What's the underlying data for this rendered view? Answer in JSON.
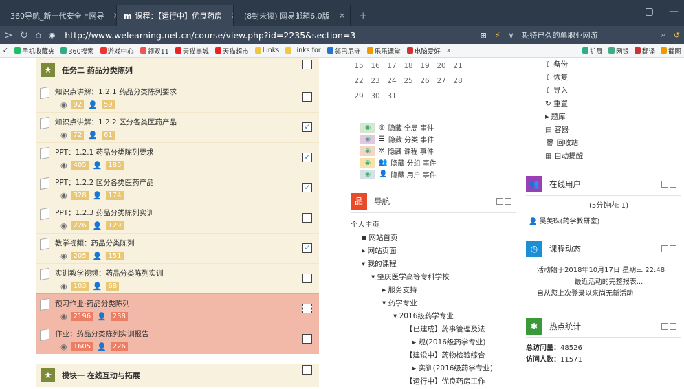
{
  "tabs": [
    {
      "label": "360导航_新一代安全上网导",
      "icon_color": "#f5a623",
      "active": false
    },
    {
      "label": "课程：【运行中】优良药房",
      "icon_color": "#ffffff",
      "active": true
    },
    {
      "label": "(8封未读) 网易邮箱6.0版",
      "icon_color": "#e33",
      "active": false
    }
  ],
  "address": {
    "url": "http://www.welearning.net.cn/course/view.php?id=2235&section=3",
    "hint": "期待已久的单职业网游"
  },
  "bookmarks": [
    "手机收藏夹",
    "360搜索",
    "游戏中心",
    "领双11",
    "天猫商城",
    "天猫超市",
    "Links",
    "Links for",
    "邻巴尼守",
    "乐乐课堂",
    "电脑爱好"
  ],
  "bookmarks_right": [
    "扩展",
    "网银",
    "翻译",
    "截图"
  ],
  "section_title": "任务二 药品分类陈列",
  "items": [
    {
      "name": "知识点讲解：1.2.1 药品分类陈列要求",
      "views": "92",
      "users": "59",
      "checked": false,
      "pink": false
    },
    {
      "name": "知识点讲解：1.2.2 区分各类医药产品",
      "views": "72",
      "users": "61",
      "checked": true,
      "pink": false
    },
    {
      "name": "PPT：1.2.1 药品分类陈列要求",
      "views": "405",
      "users": "185",
      "checked": true,
      "pink": false
    },
    {
      "name": "PPT：1.2.2 区分各类医药产品",
      "views": "328",
      "users": "174",
      "checked": true,
      "pink": false
    },
    {
      "name": "PPT：1.2.3 药品分类陈列实训",
      "views": "226",
      "users": "129",
      "checked": false,
      "pink": false
    },
    {
      "name": "教学视频：药品分类陈列",
      "views": "205",
      "users": "151",
      "checked": true,
      "pink": false
    },
    {
      "name": "实训教学视频：药品分类陈列实训",
      "views": "103",
      "users": "68",
      "checked": false,
      "pink": false
    },
    {
      "name": "预习作业-药品分类陈列",
      "views": "2196",
      "users": "238",
      "checked": false,
      "pink": true,
      "dashed": true
    },
    {
      "name": "作业：药品分类陈列实训报告",
      "views": "1605",
      "users": "226",
      "checked": false,
      "pink": true
    }
  ],
  "module_title": "模块一 在线互动与拓展",
  "calendar": [
    [
      "15",
      "16",
      "17",
      "18",
      "19",
      "20",
      "21"
    ],
    [
      "22",
      "23",
      "24",
      "25",
      "26",
      "27",
      "28"
    ],
    [
      "29",
      "30",
      "31"
    ]
  ],
  "events": [
    "隐藏 全局 事件",
    "隐藏 分类 事件",
    "隐藏 课程 事件",
    "隐藏 分组 事件",
    "隐藏 用户 事件"
  ],
  "nav": {
    "title": "导航",
    "items": [
      "个人主页",
      "网站首页",
      "网站页面",
      "我的课程",
      "肇庆医学高等专科学校",
      "服务支持",
      "药学专业",
      "2016级药学专业",
      "【已建成】药事管理及法",
      "规(2016级药学专业)",
      "【建设中】药物检验综合",
      "实训(2016级药学专业)",
      "【运行中】优良药房工作"
    ]
  },
  "tools": [
    "备份",
    "恢复",
    "导入",
    "重置",
    "题库",
    "容器",
    "回收站",
    "自动提醒"
  ],
  "online": {
    "title": "在线用户",
    "note": "(5分钟内: 1)",
    "user": "吴美珠(药学教研室)"
  },
  "activity": {
    "title": "课程动态",
    "since": "活动始于2018年10月17日 星期三 22:48",
    "link": "最近活动的完整报表...",
    "none": "自从您上次登录以来尚无新活动"
  },
  "stats": {
    "title": "热点统计",
    "visits_label": "总访问量：",
    "visits": "48526",
    "people_label": "访问人数：",
    "people": "11571"
  }
}
